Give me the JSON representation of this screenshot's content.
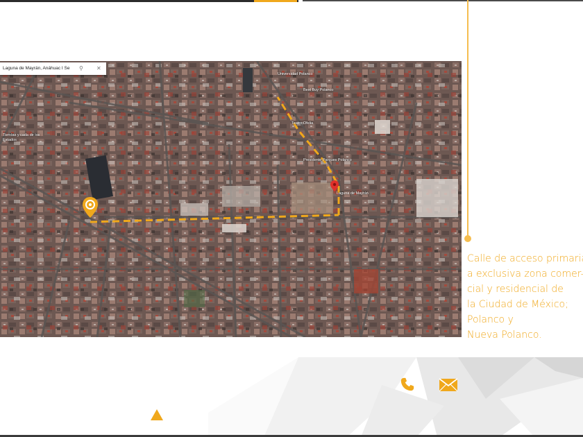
{
  "map": {
    "search_text": "Laguna de Mayrán, Anáhuac I Se",
    "search_icon": "search-icon",
    "close_icon": "close-icon",
    "labels": {
      "univ_polanco": "Universidad Polanco",
      "best_buy": "Best Buy Polanco",
      "teatro": "Teatro Ofelia",
      "presidente": "Presidente Parques Polanco",
      "destination": "Laguna de Mayrán",
      "tiendas": "Tiendas y cada de los Estados"
    },
    "route_color": "#f0a81c",
    "origin_marker": "location-target-icon",
    "destination_marker": "red-pin-icon"
  },
  "description": {
    "lines": [
      "Calle de acceso primaria",
      "a exclusiva zona comer-",
      "cial y residencial de",
      "la Ciudad de México;",
      "Polanco y",
      "Nueva Polanco."
    ]
  },
  "footer": {
    "phone_icon": "phone-icon",
    "mail_icon": "mail-icon",
    "up_icon": "scroll-up-triangle-icon"
  },
  "colors": {
    "accent": "#f0a81c",
    "timeline": "#f5bd4f"
  }
}
